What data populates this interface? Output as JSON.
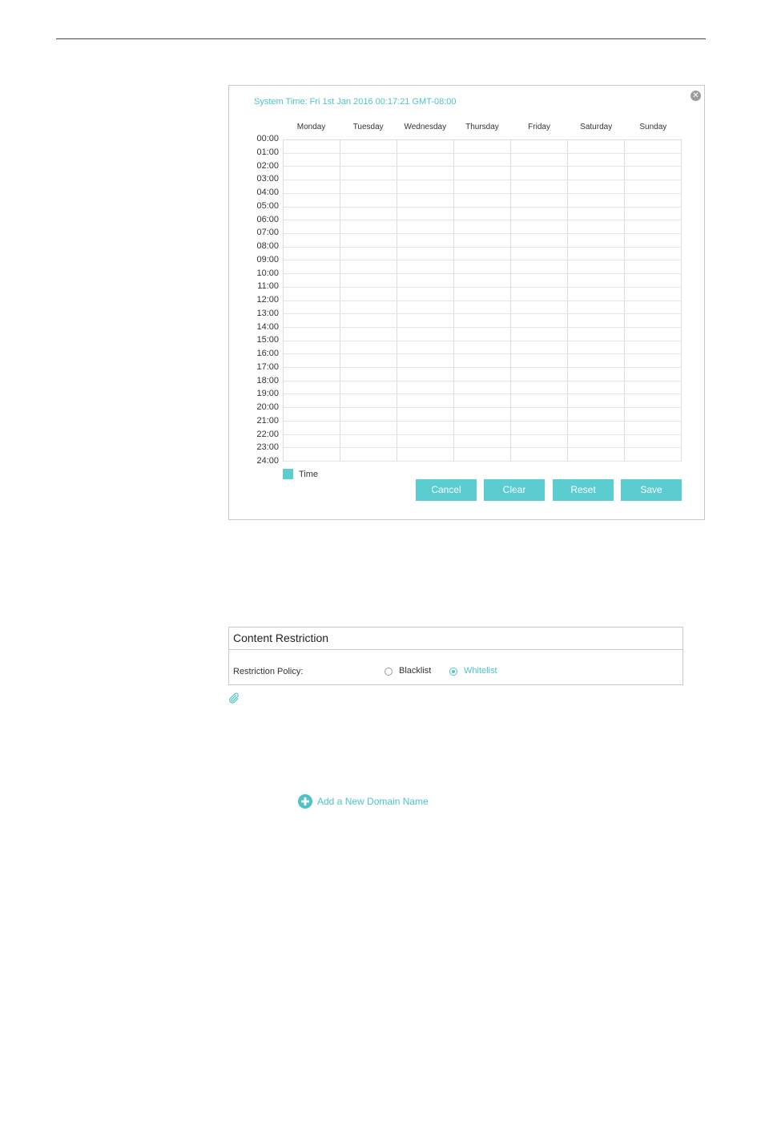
{
  "schedule": {
    "system_time": "System Time: Fri 1st Jan 2016 00:17:21 GMT-08:00",
    "days": [
      "Monday",
      "Tuesday",
      "Wednesday",
      "Thursday",
      "Friday",
      "Saturday",
      "Sunday"
    ],
    "hours": [
      "00:00",
      "01:00",
      "02:00",
      "03:00",
      "04:00",
      "05:00",
      "06:00",
      "07:00",
      "08:00",
      "09:00",
      "10:00",
      "11:00",
      "12:00",
      "13:00",
      "14:00",
      "15:00",
      "16:00",
      "17:00",
      "18:00",
      "19:00",
      "20:00",
      "21:00",
      "22:00",
      "23:00",
      "24:00"
    ],
    "legend_label": "Time",
    "buttons": {
      "cancel": "Cancel",
      "clear": "Clear",
      "reset": "Reset",
      "save": "Save"
    },
    "close_icon": "close-icon"
  },
  "content_restriction": {
    "title": "Content Restriction",
    "policy_label": "Restriction Policy:",
    "options": {
      "blacklist": "Blacklist",
      "whitelist": "Whitelist"
    },
    "selected": "whitelist"
  },
  "add_domain": {
    "label": "Add a New Domain Name",
    "icon": "plus-circle-icon"
  },
  "colors": {
    "accent": "#5bcccf",
    "accent_text": "#4fc3c6"
  }
}
